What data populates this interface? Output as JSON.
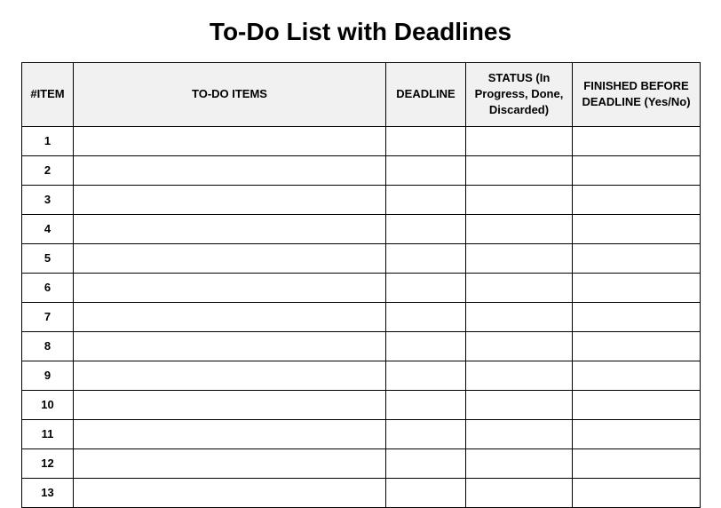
{
  "title": "To-Do List with Deadlines",
  "headers": {
    "num": "#ITEM",
    "todo": "TO-DO ITEMS",
    "deadline": "DEADLINE",
    "status": "STATUS (In Progress, Done, Discarded)",
    "finished": "FINISHED BEFORE DEADLINE (Yes/No)"
  },
  "rows": [
    {
      "num": "1",
      "todo": "",
      "deadline": "",
      "status": "",
      "finished": ""
    },
    {
      "num": "2",
      "todo": "",
      "deadline": "",
      "status": "",
      "finished": ""
    },
    {
      "num": "3",
      "todo": "",
      "deadline": "",
      "status": "",
      "finished": ""
    },
    {
      "num": "4",
      "todo": "",
      "deadline": "",
      "status": "",
      "finished": ""
    },
    {
      "num": "5",
      "todo": "",
      "deadline": "",
      "status": "",
      "finished": ""
    },
    {
      "num": "6",
      "todo": "",
      "deadline": "",
      "status": "",
      "finished": ""
    },
    {
      "num": "7",
      "todo": "",
      "deadline": "",
      "status": "",
      "finished": ""
    },
    {
      "num": "8",
      "todo": "",
      "deadline": "",
      "status": "",
      "finished": ""
    },
    {
      "num": "9",
      "todo": "",
      "deadline": "",
      "status": "",
      "finished": ""
    },
    {
      "num": "10",
      "todo": "",
      "deadline": "",
      "status": "",
      "finished": ""
    },
    {
      "num": "11",
      "todo": "",
      "deadline": "",
      "status": "",
      "finished": ""
    },
    {
      "num": "12",
      "todo": "",
      "deadline": "",
      "status": "",
      "finished": ""
    },
    {
      "num": "13",
      "todo": "",
      "deadline": "",
      "status": "",
      "finished": ""
    }
  ]
}
